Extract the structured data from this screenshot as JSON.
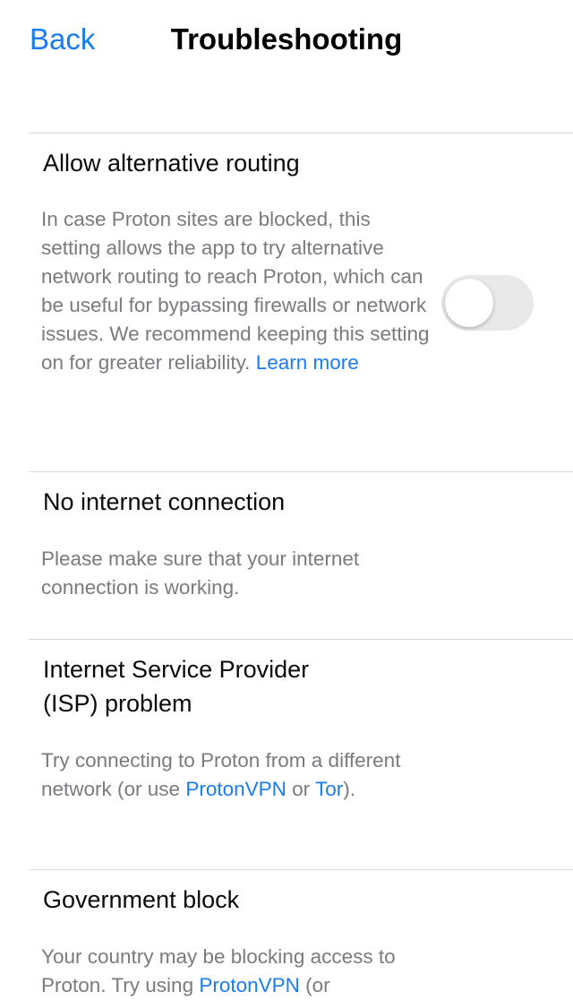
{
  "nav": {
    "back_label": "Back",
    "title": "Troubleshooting"
  },
  "sections": [
    {
      "title": "Allow alternative routing",
      "desc_parts": [
        "In case Proton sites are blocked, this setting allows the app to try alternative network routing to reach Proton, which can be useful for bypassing firewalls or network issues. We recommend keeping this setting on for greater reliability. "
      ],
      "link_learn_more": "Learn more",
      "toggle_on": false
    },
    {
      "title": "No internet connection",
      "desc": "Please make sure that your internet connection is working."
    },
    {
      "title_line1": "Internet Service Provider",
      "title_line2": "(ISP) problem",
      "desc_before": "Try connecting to Proton from a different network (or use ",
      "link_protonvpn": "ProtonVPN",
      "desc_mid": " or ",
      "link_tor": "Tor",
      "desc_after": ")."
    },
    {
      "title": "Government block",
      "desc_before": "Your country may be blocking access to Proton. Try using ",
      "link_protonvpn": "ProtonVPN",
      "desc_after": " (or"
    }
  ],
  "colors": {
    "accent": "#1a7bf2",
    "secondary_text": "#7a7a80",
    "divider": "#d8d8dc",
    "toggle_off": "#e9e9ea"
  }
}
